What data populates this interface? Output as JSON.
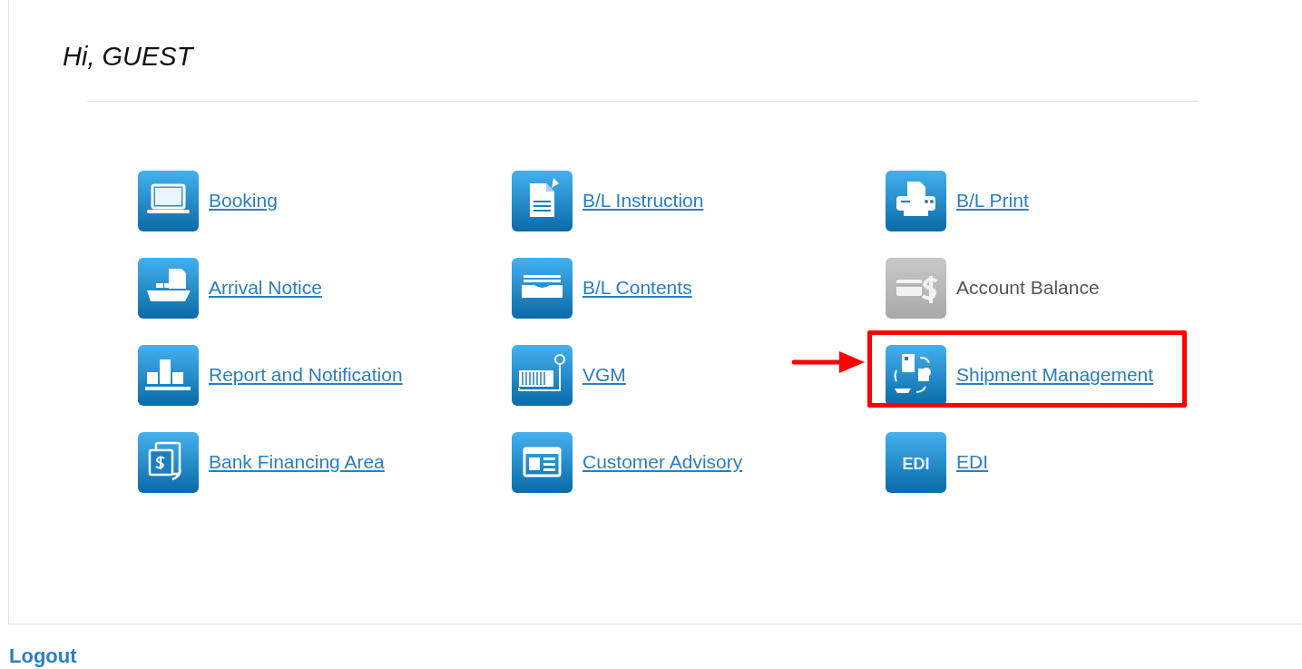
{
  "greeting": "Hi, GUEST",
  "menu": [
    {
      "label": "Booking",
      "kind": "link",
      "highlighted": false
    },
    {
      "label": "B/L Instruction",
      "kind": "link",
      "highlighted": false
    },
    {
      "label": "B/L Print",
      "kind": "link",
      "highlighted": false
    },
    {
      "label": "Arrival Notice",
      "kind": "link",
      "highlighted": false
    },
    {
      "label": "B/L Contents",
      "kind": "link",
      "highlighted": false
    },
    {
      "label": "Account Balance",
      "kind": "disabled",
      "highlighted": false
    },
    {
      "label": "Report and Notification",
      "kind": "link",
      "highlighted": false
    },
    {
      "label": "VGM",
      "kind": "link",
      "highlighted": false
    },
    {
      "label": "Shipment Management",
      "kind": "link",
      "highlighted": true
    },
    {
      "label": "Bank Financing Area",
      "kind": "link",
      "highlighted": false
    },
    {
      "label": "Customer Advisory",
      "kind": "link",
      "highlighted": false
    },
    {
      "label": "EDI",
      "kind": "link",
      "highlighted": false,
      "icon_text": "EDI"
    }
  ],
  "logout": "Logout"
}
